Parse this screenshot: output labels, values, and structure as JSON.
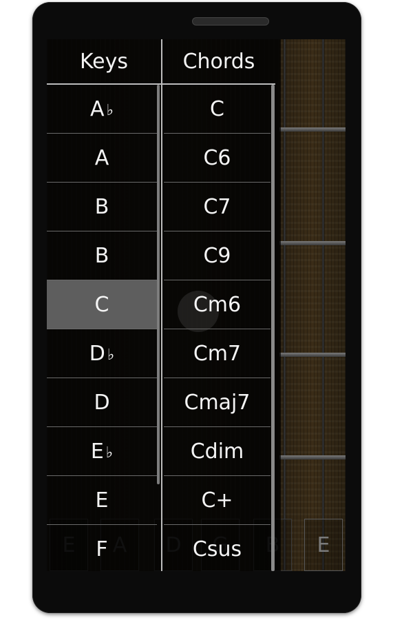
{
  "panels": {
    "keys_header": "Keys",
    "chords_header": "Chords"
  },
  "keys": [
    {
      "label": "A",
      "accidental": "♭"
    },
    {
      "label": "A",
      "accidental": ""
    },
    {
      "label": "B",
      "accidental": ""
    },
    {
      "label": "B",
      "accidental": ""
    },
    {
      "label": "C",
      "accidental": "",
      "selected": true
    },
    {
      "label": "D",
      "accidental": "♭"
    },
    {
      "label": "D",
      "accidental": ""
    },
    {
      "label": "E",
      "accidental": "♭"
    },
    {
      "label": "E",
      "accidental": ""
    },
    {
      "label": "F",
      "accidental": ""
    }
  ],
  "chords": [
    "C",
    "C6",
    "C7",
    "C9",
    "Cm6",
    "Cm7",
    "Cmaj7",
    "Cdim",
    "C+",
    "Csus"
  ],
  "string_tabs": [
    "E",
    "A",
    "D",
    "G",
    "B",
    "E"
  ],
  "colors": {
    "selected_row": "#5e5e5e",
    "divider": "#bdbdbd",
    "text": "#f4f4f4"
  }
}
